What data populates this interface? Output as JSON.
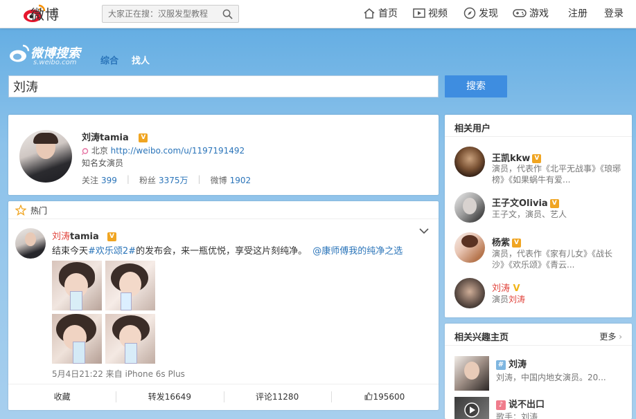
{
  "nav": {
    "logo_text": "微博",
    "search_placeholder": "大家正在搜：汉服发型教程",
    "links": [
      "首页",
      "视频",
      "发现",
      "游戏"
    ],
    "register": "注册",
    "login": "登录"
  },
  "search": {
    "brand_title": "微博搜索",
    "brand_sub": "s.weibo.com",
    "tabs": [
      "综合",
      "找人"
    ],
    "query": "刘涛",
    "button": "搜索"
  },
  "user_card": {
    "name": "刘涛tamia",
    "location": "北京",
    "url": "http://weibo.com/u/1197191492",
    "desc": "知名女演员",
    "follow_label": "关注",
    "follow": "399",
    "fans_label": "粉丝",
    "fans": "3375万",
    "weibo_label": "微博",
    "weibo": "1902"
  },
  "hot": {
    "label": "热门",
    "post_name_hl": "刘涛",
    "post_name_rest": "tamia",
    "text_1": "结束今天",
    "text_tag": "#欢乐颂2#",
    "text_2": "的发布会，来一瓶优悦，享受这片刻纯净。",
    "text_link": "@康师傅我的纯净之选",
    "meta": "5月4日21:22 来自 iPhone 6s Plus",
    "actions": [
      "收藏",
      "转发16649",
      "评论11280",
      "195600"
    ]
  },
  "related": {
    "title": "相关用户",
    "users": [
      {
        "name": "王凯kkw",
        "desc": "演员，代表作《北平无战事》《琅琊榜》《如果蜗牛有爱..."
      },
      {
        "name": "王子文Olivia",
        "desc": "王子文，演员、艺人"
      },
      {
        "name": "杨紫",
        "desc": "演员，代表作《家有儿女》《战长沙》《欢乐颂》《青云..."
      },
      {
        "name": "刘涛",
        "desc_1": "演员",
        "desc_hl": "刘涛"
      }
    ]
  },
  "interest": {
    "title": "相关兴趣主页",
    "more": "更多",
    "items": [
      {
        "name": "刘涛",
        "desc": "刘涛，中国内地女演员。20..."
      },
      {
        "name": "说不出口",
        "desc": "歌手：刘涛"
      }
    ]
  },
  "colors": {
    "accent": "#2a74b9",
    "button": "#3e8de0",
    "highlight": "#e0433b",
    "verified": "#f0a522"
  }
}
